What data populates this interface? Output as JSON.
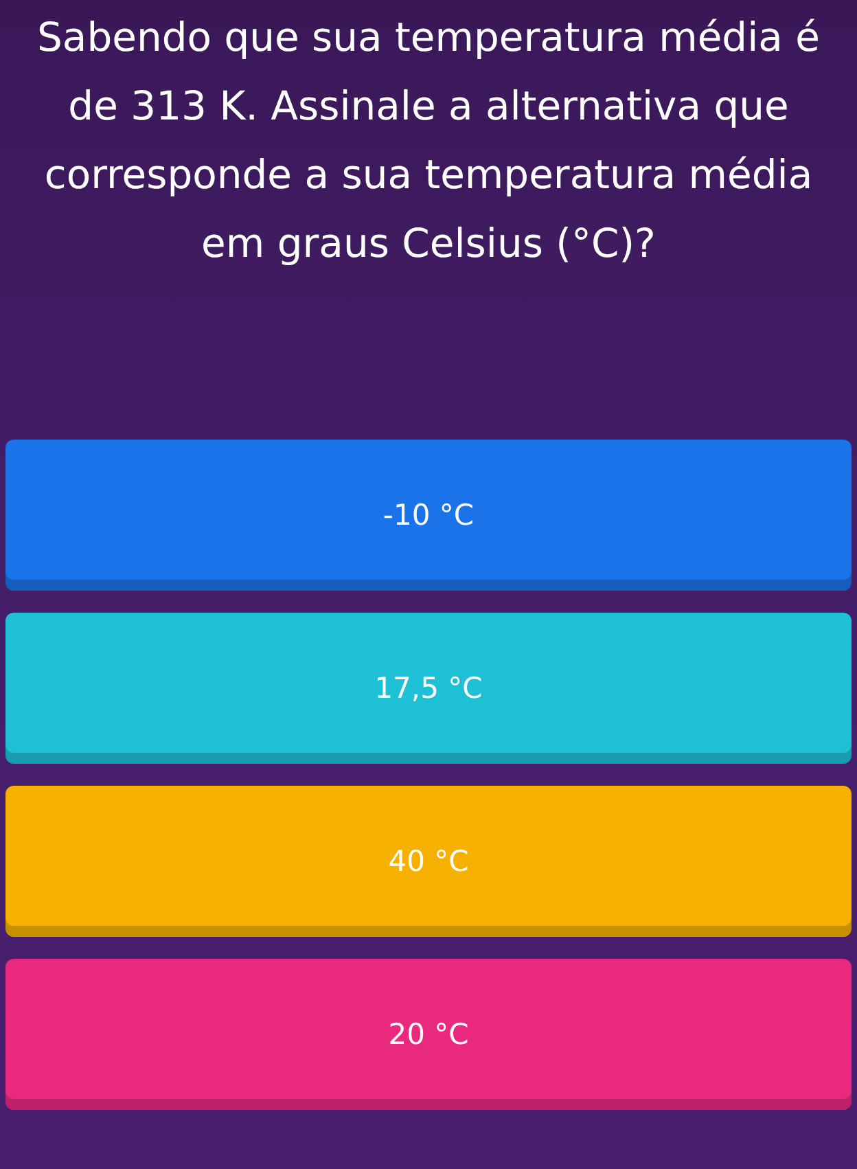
{
  "question": "Sabendo que sua temperatura média é de 313 K. Assinale a alternativa que corresponde a sua temperatura média em graus Celsius (°C)?",
  "answers": [
    {
      "label": "-10 °C",
      "color": "#1a73e8"
    },
    {
      "label": "17,5 °C",
      "color": "#1ec0d6"
    },
    {
      "label": "40 °C",
      "color": "#f5b000"
    },
    {
      "label": "20 °C",
      "color": "#e8297e"
    }
  ]
}
